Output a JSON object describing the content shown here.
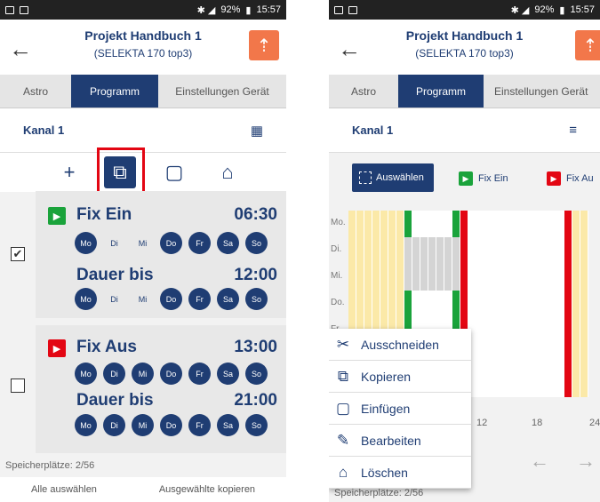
{
  "status": {
    "percent": "92%",
    "time": "15:57"
  },
  "header": {
    "title": "Projekt Handbuch 1",
    "subtitle": "(SELEKTA 170 top3)"
  },
  "tabs": [
    "Astro",
    "Programm",
    "Einstellungen Gerät"
  ],
  "channel": "Kanal 1",
  "entries": [
    {
      "name": "Fix Ein",
      "time": "06:30",
      "checked": true,
      "duration_label": "Dauer bis",
      "duration_time": "12:00",
      "days": [
        "Mo",
        "Di",
        "Mi",
        "Do",
        "Fr",
        "Sa",
        "So"
      ],
      "days_on": [
        true,
        false,
        false,
        true,
        true,
        true,
        true
      ],
      "duration_days_on": [
        true,
        false,
        false,
        true,
        true,
        true,
        true
      ]
    },
    {
      "name": "Fix Aus",
      "time": "13:00",
      "checked": false,
      "duration_label": "Dauer bis",
      "duration_time": "21:00",
      "days": [
        "Mo",
        "Di",
        "Mi",
        "Do",
        "Fr",
        "Sa",
        "So"
      ],
      "days_on": [
        true,
        true,
        true,
        true,
        true,
        true,
        true
      ],
      "duration_days_on": [
        true,
        true,
        true,
        true,
        true,
        true,
        true
      ]
    }
  ],
  "footer": {
    "slots": "Speicherplätze: 2/56",
    "select_all": "Alle auswählen",
    "copy_selected": "Ausgewählte kopieren"
  },
  "right": {
    "tab_einstellungen": "Einstellungen Gerät",
    "select_button": "Auswählen",
    "legend_on": "Fix Ein",
    "legend_off": "Fix Au",
    "weekdays": [
      "Mo.",
      "Di.",
      "Mi.",
      "Do.",
      "Fr."
    ],
    "axis_ticks": [
      "12",
      "18",
      "24"
    ],
    "context_menu": [
      "Ausschneiden",
      "Kopieren",
      "Einfügen",
      "Bearbeiten",
      "Löschen"
    ],
    "footer_slots": "Speicherplätze: 2/56"
  },
  "colors": {
    "navy": "#1f3d73",
    "orange": "#f2774a",
    "green": "#1aa33b",
    "red": "#e30613",
    "yellow": "#fbe9a8"
  },
  "icons": [
    "back-arrow-icon",
    "antenna-icon",
    "grid-view-icon",
    "list-view-icon",
    "add-icon",
    "copy-icon",
    "paste-icon",
    "delete-icon",
    "scissors-icon",
    "pencil-icon",
    "checkbox-icon",
    "play-icon"
  ]
}
